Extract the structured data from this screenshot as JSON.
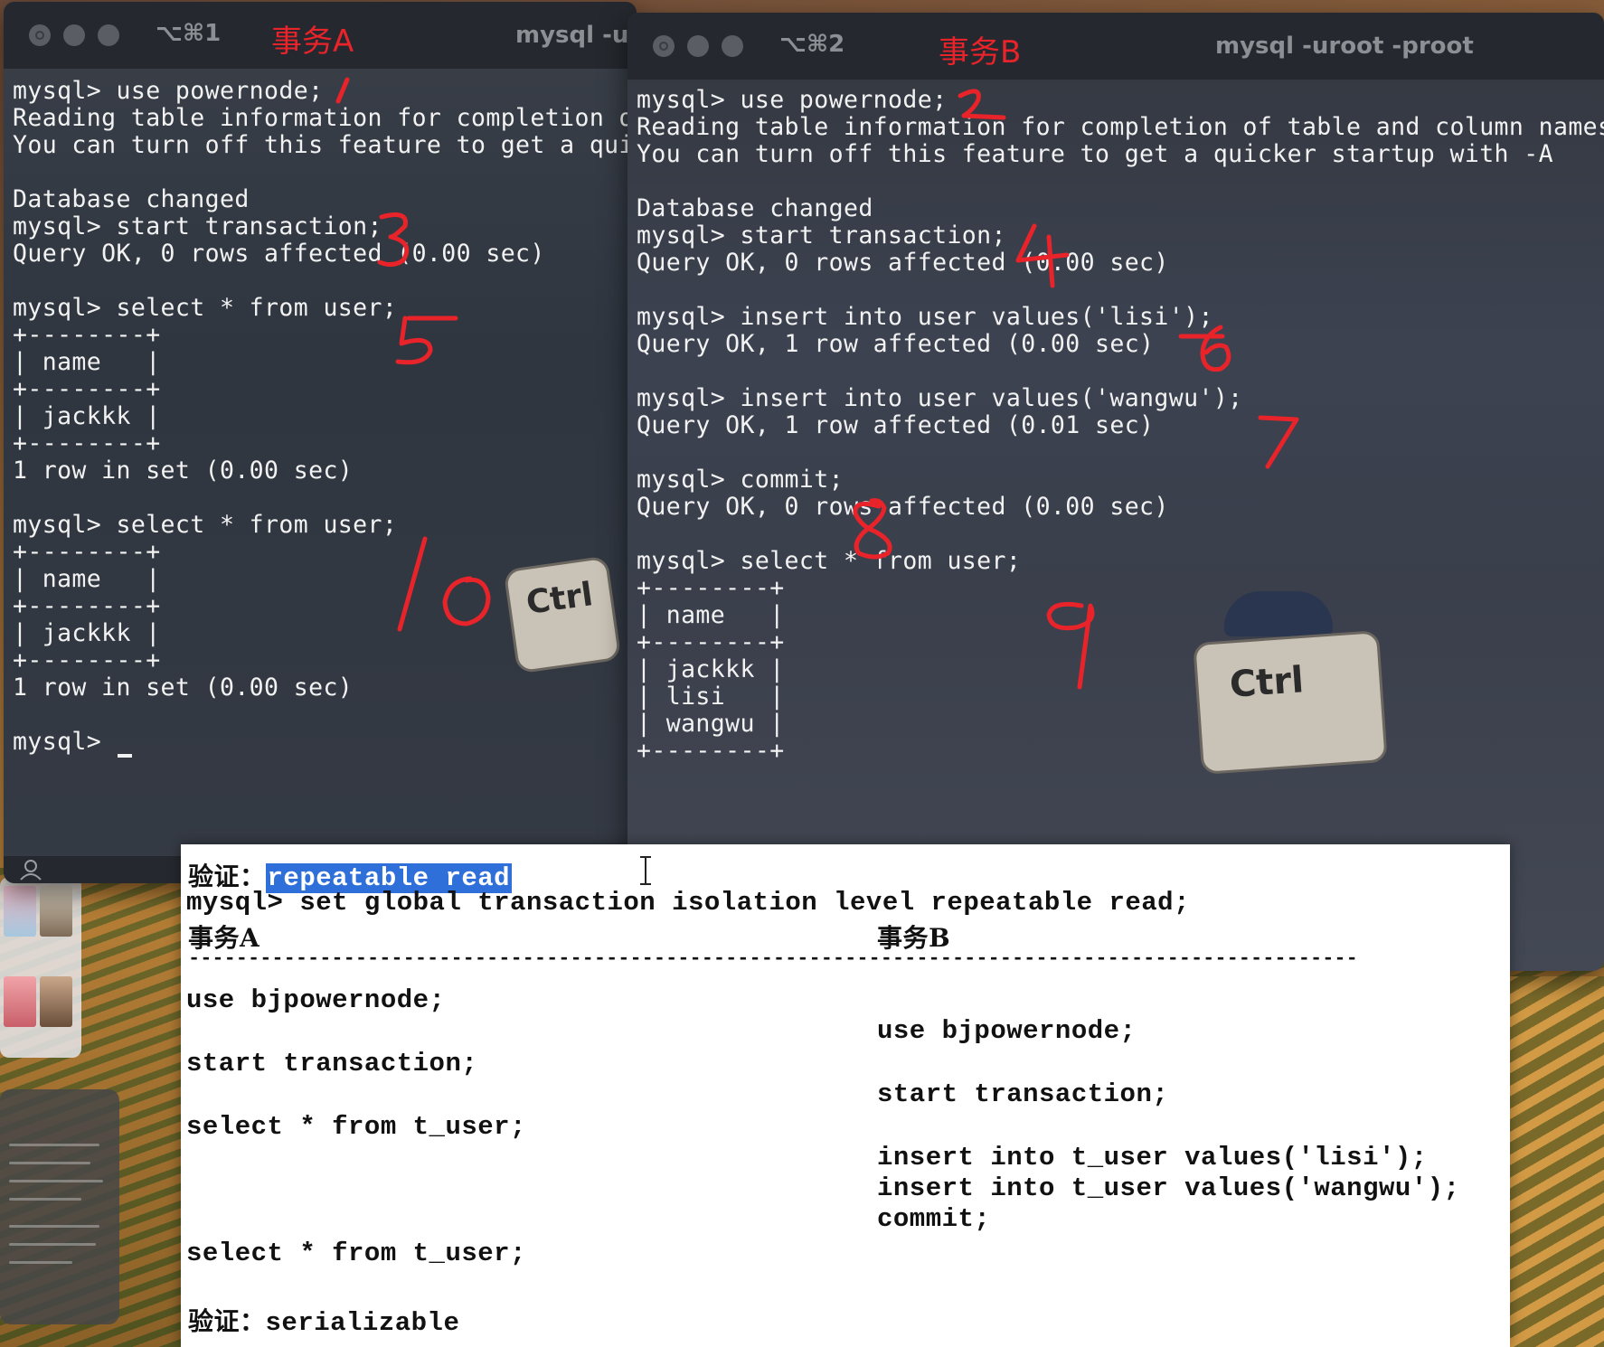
{
  "terminal_a": {
    "shortcut": "⌥⌘1",
    "label": "事务A",
    "title": "mysql -uroot -proot",
    "lines": [
      "mysql> use powernode;",
      "Reading table information for completion of table and column names",
      "You can turn off this feature to get a quicker startup with -A",
      "",
      "Database changed",
      "mysql> start transaction;",
      "Query OK, 0 rows affected (0.00 sec)",
      "",
      "mysql> select * from user;",
      "+--------+",
      "| name   |",
      "+--------+",
      "| jackkk |",
      "+--------+",
      "1 row in set (0.00 sec)",
      "",
      "mysql> select * from user;",
      "+--------+",
      "| name   |",
      "+--------+",
      "| jackkk |",
      "+--------+",
      "1 row in set (0.00 sec)",
      "",
      "mysql> "
    ]
  },
  "terminal_b": {
    "shortcut": "⌥⌘2",
    "label": "事务B",
    "title": "mysql -uroot -proot",
    "lines": [
      "mysql> use powernode;",
      "Reading table information for completion of table and column names",
      "You can turn off this feature to get a quicker startup with -A",
      "",
      "Database changed",
      "mysql> start transaction;",
      "Query OK, 0 rows affected (0.00 sec)",
      "",
      "mysql> insert into user values('lisi');",
      "Query OK, 1 row affected (0.00 sec)",
      "",
      "mysql> insert into user values('wangwu');",
      "Query OK, 1 row affected (0.01 sec)",
      "",
      "mysql> commit;",
      "Query OK, 0 rows affected (0.00 sec)",
      "",
      "mysql> select * from user;",
      "+--------+",
      "| name   |",
      "+--------+",
      "| jackkk |",
      "| lisi   |",
      "| wangwu |",
      "+--------+"
    ]
  },
  "mascot_text": "Ctrl",
  "annotations": [
    "1",
    "2",
    "3",
    "4",
    "5",
    "6",
    "7",
    "8",
    "9",
    "10"
  ],
  "document": {
    "verify1_label": "验证：",
    "verify1_value": "repeatable read",
    "set_cmd": "mysql> set global transaction isolation level repeatable read;",
    "col_a": "事务A",
    "col_b": "事务B",
    "divider": "--------------------------------------------------------------------------------------------------",
    "a1": "use bjpowernode;",
    "b1": "use bjpowernode;",
    "a2": "start transaction;",
    "b2": "start transaction;",
    "a3": "select * from t_user;",
    "b3": "insert into t_user values('lisi');",
    "b4": "insert into t_user values('wangwu');",
    "b5": "commit;",
    "a4": "select * from t_user;",
    "verify2_label": "验证：",
    "verify2_value": "serializable"
  },
  "colors": {
    "annotation_red": "#e8242a",
    "highlight_blue": "#2e6fd9",
    "terminal_text": "#f2f2f2"
  }
}
